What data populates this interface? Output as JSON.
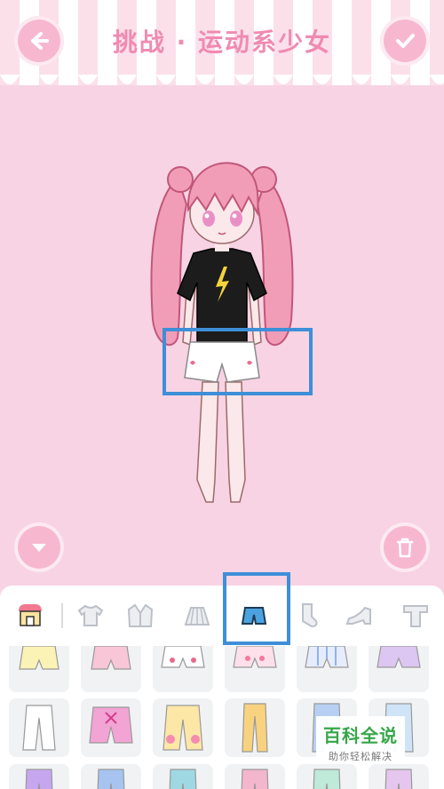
{
  "header": {
    "title": "挑战 · 运动系少女",
    "back_icon": "back-arrow-icon",
    "confirm_icon": "checkmark-icon"
  },
  "colors": {
    "background": "#f7d3e3",
    "accent_pink": "#f7b8cf",
    "title_pink": "#f08bb0",
    "highlight_blue": "#3e8fd8",
    "watermark_green": "#37a64a"
  },
  "stage": {
    "collapse_icon": "chevron-down-icon",
    "delete_icon": "trash-icon"
  },
  "category_tabs": [
    {
      "name": "shop",
      "icon": "shop-icon",
      "selected": false
    },
    {
      "name": "tshirt",
      "icon": "tshirt-icon",
      "selected": false
    },
    {
      "name": "jacket",
      "icon": "jacket-icon",
      "selected": false
    },
    {
      "name": "skirt",
      "icon": "skirt-icon",
      "selected": false
    },
    {
      "name": "shorts",
      "icon": "shorts-icon",
      "selected": true
    },
    {
      "name": "socks",
      "icon": "sock-icon",
      "selected": false
    },
    {
      "name": "shoes",
      "icon": "heel-shoe-icon",
      "selected": false
    },
    {
      "name": "top",
      "icon": "top-icon",
      "selected": false
    }
  ],
  "items": [
    "yellow-bloomers",
    "pink-bloomers",
    "white-heart-shorts",
    "pink-ribbon-bloomers",
    "striped-bloomers",
    "lavender-bloomers",
    "white-pants",
    "pink-lace-shorts",
    "yellow-heart-pants",
    "yellow-trousers",
    "blue-pants",
    "light-blue-pants",
    "purple-pants",
    "blue-pants-2",
    "teal-pants",
    "pink-pants",
    "mint-pants",
    "lavender-pants"
  ],
  "watermark": {
    "main": "百科全说",
    "sub": "助你轻松解决"
  }
}
